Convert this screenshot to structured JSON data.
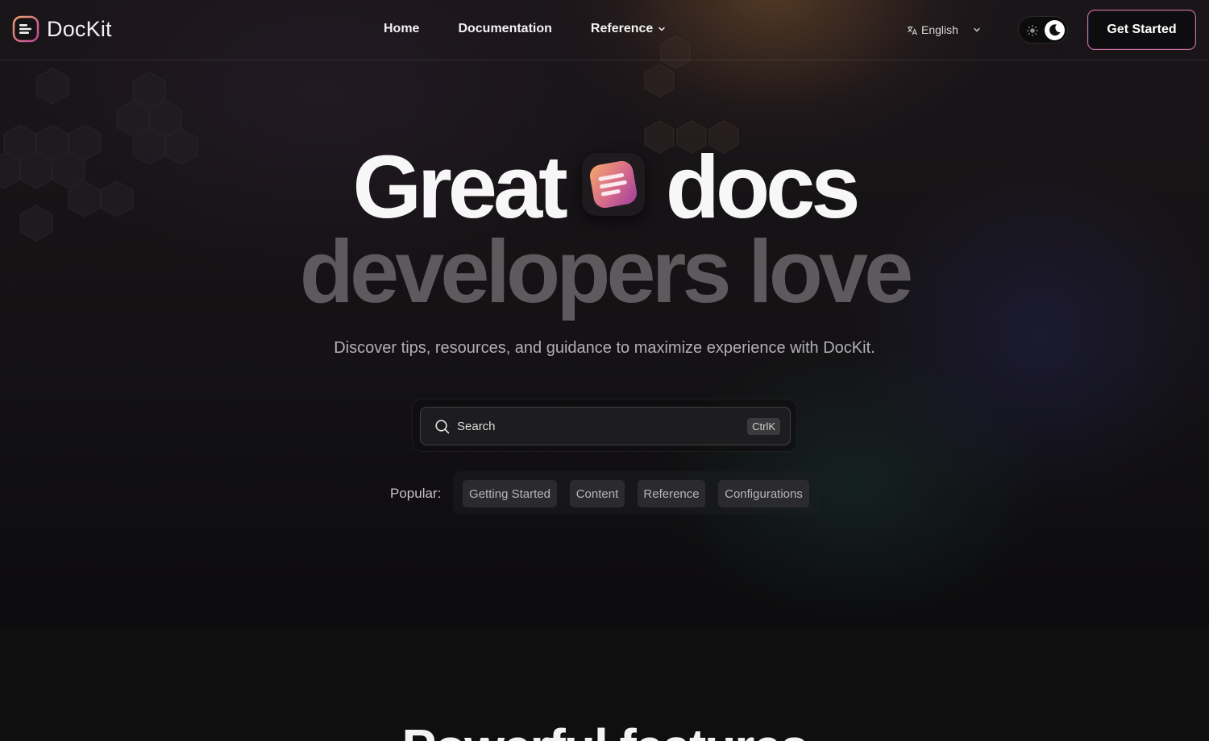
{
  "brand": {
    "name": "DocKit",
    "logo_icon": "dockit-logo-icon"
  },
  "nav": {
    "items": [
      {
        "label": "Home"
      },
      {
        "label": "Documentation"
      },
      {
        "label": "Reference",
        "has_dropdown": true
      }
    ],
    "language": {
      "label": "English",
      "icon": "translate-icon"
    },
    "theme": {
      "mode": "dark",
      "icons": [
        "sun-icon",
        "moon-icon"
      ]
    },
    "cta_label": "Get Started"
  },
  "hero": {
    "headline_word1": "Great",
    "headline_word2": "docs",
    "headline_line2": "developers love",
    "subtitle": "Discover tips, resources, and guidance to maximize experience with DocKit.",
    "search": {
      "placeholder": "Search",
      "shortcut": "CtrlK"
    },
    "popular_label": "Popular:",
    "popular_tags": [
      "Getting Started",
      "Content",
      "Reference",
      "Configurations"
    ]
  },
  "features": {
    "title_partial": "Powerful features"
  },
  "colors": {
    "background": "#0f0f10",
    "cta_border": "#c7728f",
    "headline_primary": "#f7f7f7",
    "headline_secondary": "#5c5a5c",
    "accent_gradient_start": "#f0a46a",
    "accent_gradient_end": "#b9469c"
  }
}
